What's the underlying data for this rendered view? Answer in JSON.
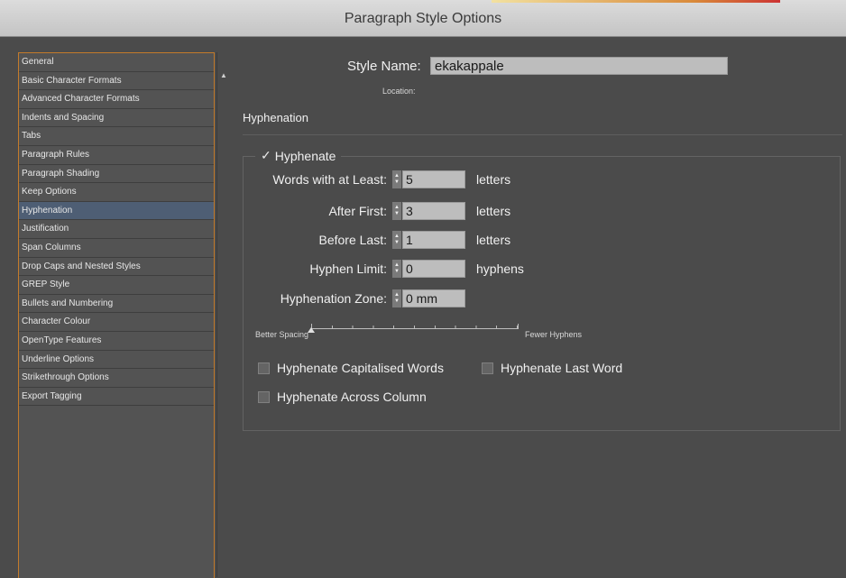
{
  "window": {
    "title": "Paragraph Style Options"
  },
  "sidebar": {
    "items": [
      {
        "label": "General"
      },
      {
        "label": "Basic Character Formats"
      },
      {
        "label": "Advanced Character Formats"
      },
      {
        "label": "Indents and Spacing"
      },
      {
        "label": "Tabs"
      },
      {
        "label": "Paragraph Rules"
      },
      {
        "label": "Paragraph Shading"
      },
      {
        "label": "Keep Options"
      },
      {
        "label": "Hyphenation"
      },
      {
        "label": "Justification"
      },
      {
        "label": "Span Columns"
      },
      {
        "label": "Drop Caps and Nested Styles"
      },
      {
        "label": "GREP Style"
      },
      {
        "label": "Bullets and Numbering"
      },
      {
        "label": "Character Colour"
      },
      {
        "label": "OpenType Features"
      },
      {
        "label": "Underline Options"
      },
      {
        "label": "Strikethrough Options"
      },
      {
        "label": "Export Tagging"
      }
    ],
    "selected": "Hyphenation",
    "scroll_icon": "triangle-up-icon"
  },
  "main": {
    "style_name_label": "Style Name:",
    "style_name_value": "ekakappale",
    "location_label": "Location:",
    "section_title": "Hyphenation",
    "hyphenate": {
      "label": "Hyphenate",
      "checked": true
    },
    "fields": [
      {
        "label": "Words with at Least:",
        "value": "5",
        "unit": "letters"
      },
      {
        "label": "After First:",
        "value": "3",
        "unit": "letters"
      },
      {
        "label": "Before Last:",
        "value": "1",
        "unit": "letters"
      },
      {
        "label": "Hyphen Limit:",
        "value": "0",
        "unit": "hyphens"
      },
      {
        "label": "Hyphenation Zone:",
        "value": "0 mm",
        "unit": ""
      }
    ],
    "slider": {
      "left_label": "Better Spacing",
      "right_label": "Fewer Hyphens",
      "value_fraction": 0
    },
    "options": {
      "capitalised": {
        "label": "Hyphenate Capitalised Words",
        "checked": false
      },
      "last_word": {
        "label": "Hyphenate Last Word",
        "checked": false
      },
      "across_column": {
        "label": "Hyphenate Across Column",
        "checked": false
      }
    }
  },
  "colors": {
    "selected_row": "#4e5e74",
    "sidebar_border": "#c47b2a",
    "field_bg": "#bdbdbd"
  }
}
